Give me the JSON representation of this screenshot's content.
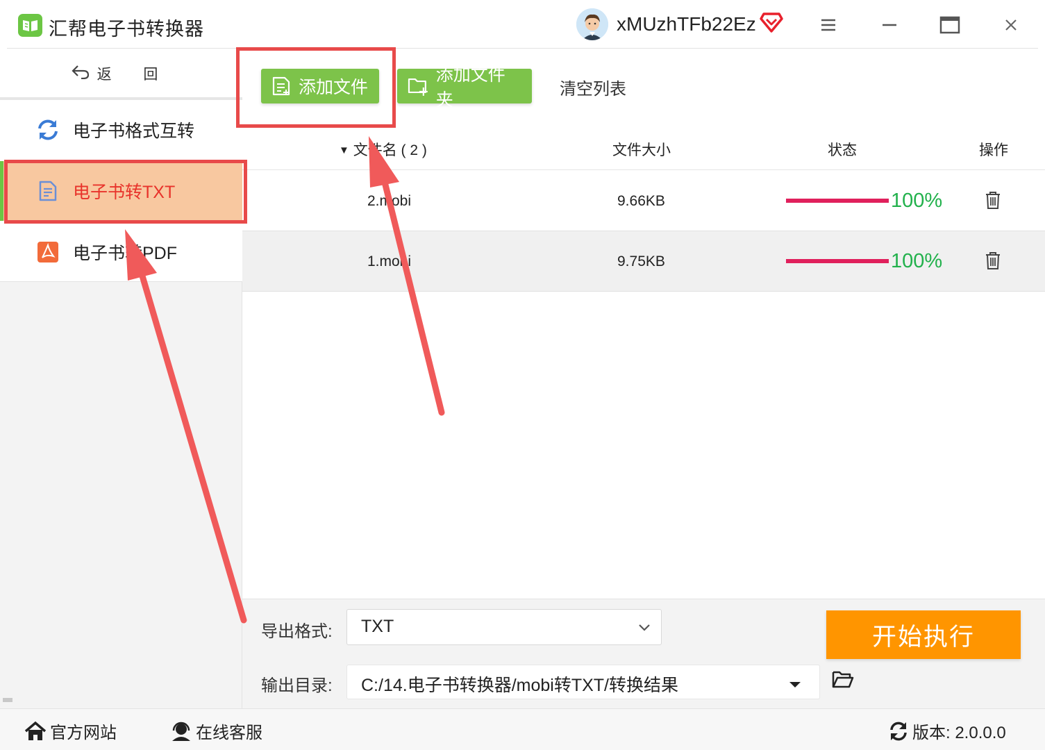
{
  "app": {
    "title": "汇帮电子书转换器",
    "username": "xMUzhTFb22Ez"
  },
  "sidebar": {
    "back_label": "返 回",
    "items": [
      {
        "label": "电子书格式互转",
        "icon": "refresh-icon",
        "active": false
      },
      {
        "label": "电子书转TXT",
        "icon": "document-icon",
        "active": true
      },
      {
        "label": "电子书转PDF",
        "icon": "pdf-icon",
        "active": false
      }
    ]
  },
  "toolbar": {
    "add_file_label": "添加文件",
    "add_folder_label": "添加文件夹",
    "clear_list_label": "清空列表"
  },
  "table": {
    "columns": {
      "name": "文件名 ( 2 )",
      "size": "文件大小",
      "status": "状态",
      "action": "操作"
    },
    "rows": [
      {
        "name": "2.mobi",
        "size": "9.66KB",
        "progress": 1.0,
        "progress_label": "100%"
      },
      {
        "name": "1.mobi",
        "size": "9.75KB",
        "progress": 1.0,
        "progress_label": "100%"
      }
    ]
  },
  "options": {
    "format_label": "导出格式:",
    "format_value": "TXT",
    "output_label": "输出目录:",
    "output_value": "C:/14.电子书转换器/mobi转TXT/转换结果",
    "start_label": "开始执行"
  },
  "footer": {
    "website_label": "官方网站",
    "support_label": "在线客服",
    "version_label": "版本:  2.0.0.0"
  },
  "colors": {
    "accent_green": "#7dc34a",
    "start_orange": "#ff9500",
    "progress_bar": "#e0205c",
    "progress_text": "#22b14c",
    "annotation_red": "#e84a4a",
    "active_item_bg": "#f8c8a0"
  }
}
